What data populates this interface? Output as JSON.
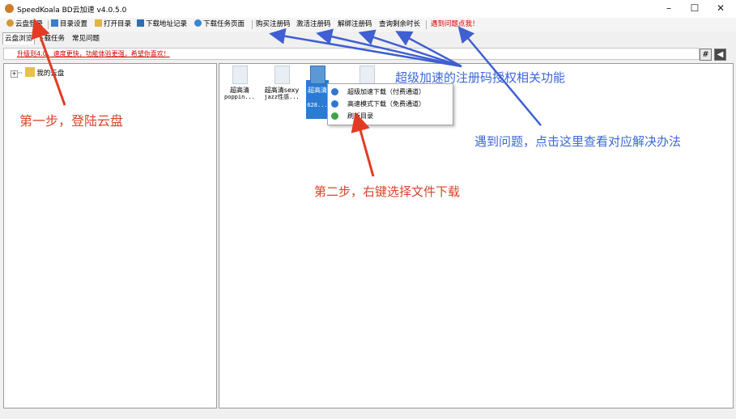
{
  "window": {
    "title": "SpeedKoala BD云加速 v4.0.5.0",
    "minimize": "–",
    "maximize": "☐",
    "close": "✕"
  },
  "toolbar": {
    "login": "云盘登录",
    "dir_settings": "目录设置",
    "open_dir": "打开目录",
    "download_history": "下载地址记录",
    "task_page": "下载任务页面",
    "buy_code": "购买注册码",
    "activate_code": "激活注册码",
    "unbind_code": "解绑注册码",
    "check_time": "查询剩余时长",
    "report_issue": "遇到问题点我！"
  },
  "tabs": [
    "云盘浏览",
    "下载任务",
    "常见问题"
  ],
  "notice": "升级到4.0，速度更快，功能体验更强，希望你喜欢！",
  "side_buttons": {
    "grid": "#",
    "collapse": "◀"
  },
  "tree": {
    "root": "我的云盘",
    "expander": "+"
  },
  "files": [
    {
      "line1": "超高清",
      "line2": "poppin..."
    },
    {
      "line1": "超高清sexy",
      "line2": "jazz性感..."
    },
    {
      "line1": "超高清",
      "line2": "628..."
    },
    {
      "line1": "",
      "line2": ""
    }
  ],
  "context_menu": [
    "超级加速下载（付费通道）",
    "高速模式下载（免费通道）",
    "刷新目录"
  ],
  "annotations": {
    "step1": "第一步，登陆云盘",
    "step2": "第二步，右键选择文件下载",
    "reg_features": "超级加速的注册码授权相关功能",
    "help": "遇到问题，点击这里查看对应解决办法"
  },
  "colors": {
    "annotation_red": "#d9442b",
    "annotation_blue": "#3c67d6",
    "notice_red": "#d00000",
    "selection_blue": "#2a7bd4"
  }
}
